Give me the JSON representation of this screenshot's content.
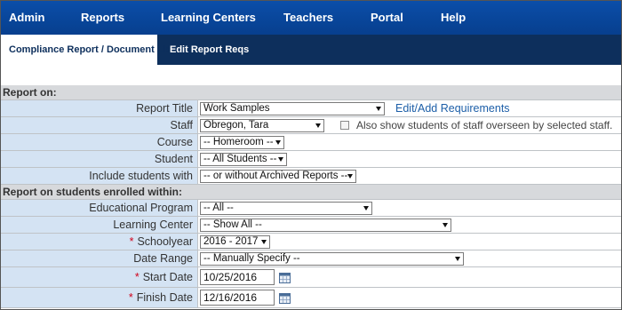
{
  "topnav": {
    "items": [
      {
        "label": "Admin"
      },
      {
        "label": "Reports"
      },
      {
        "label": "Learning Centers"
      },
      {
        "label": "Teachers"
      },
      {
        "label": "Portal"
      },
      {
        "label": "Help"
      }
    ]
  },
  "subnav": {
    "tabs": [
      {
        "label": "Compliance Report / Document List",
        "active": true
      },
      {
        "label": "Edit Report Reqs",
        "active": false
      }
    ]
  },
  "form": {
    "section1": "Report on:",
    "section2": "Report on students enrolled within:",
    "report_title": {
      "label": "Report Title",
      "value": "Work Samples",
      "link": "Edit/Add Requirements"
    },
    "staff": {
      "label": "Staff",
      "value": "Obregon, Tara",
      "checkbox_label": "Also show students of staff overseen by selected staff.",
      "checked": false
    },
    "course": {
      "label": "Course",
      "value": "-- Homeroom --"
    },
    "student": {
      "label": "Student",
      "value": "-- All Students --"
    },
    "include": {
      "label": "Include students with",
      "value": "-- or without Archived Reports --"
    },
    "program": {
      "label": "Educational Program",
      "value": "-- All --"
    },
    "center": {
      "label": "Learning Center",
      "value": "-- Show All --"
    },
    "schoolyear": {
      "label": "Schoolyear",
      "value": "2016 - 2017",
      "required_mark": "*"
    },
    "date_range": {
      "label": "Date Range",
      "value": "-- Manually Specify --"
    },
    "start_date": {
      "label": "Start Date",
      "value": "10/25/2016",
      "required_mark": "*"
    },
    "finish_date": {
      "label": "Finish Date",
      "value": "12/16/2016",
      "required_mark": "*"
    }
  },
  "colors": {
    "nav_bg": "#0b4ea9",
    "subnav_bg": "#0d2f5c",
    "label_bg": "#d4e3f3",
    "section_bg": "#d7d9dc",
    "link": "#1d5fa8",
    "required": "#d0021b"
  },
  "icons": {
    "calendar": "calendar-icon",
    "dropdown": "chevron-down-icon"
  }
}
